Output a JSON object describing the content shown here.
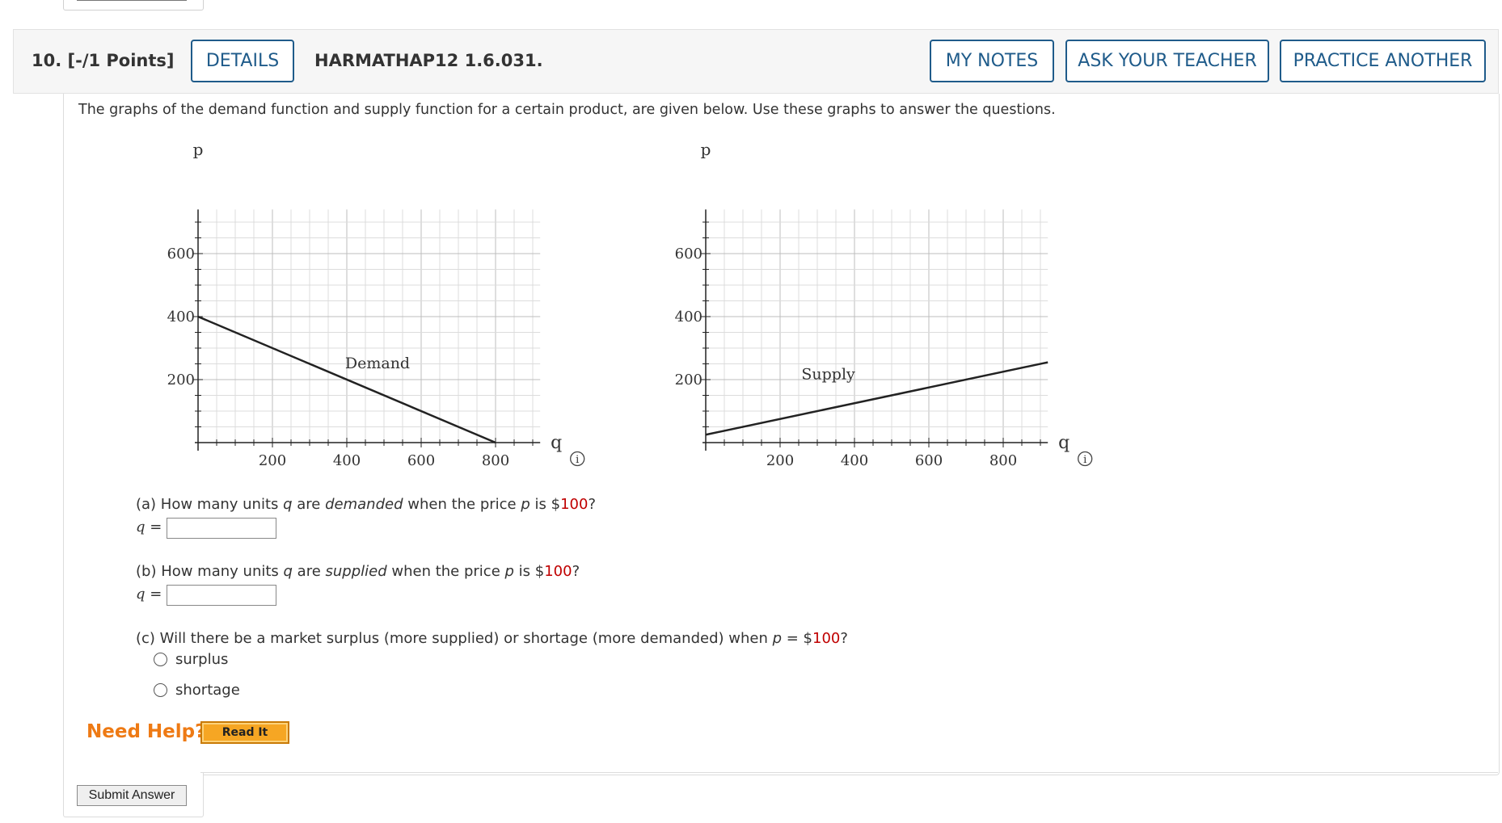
{
  "question": {
    "number_label": "10.  [-/1 Points]",
    "details_label": "DETAILS",
    "code": "HARMATHAP12 1.6.031.",
    "my_notes_label": "MY NOTES",
    "ask_teacher_label": "ASK YOUR TEACHER",
    "practice_label": "PRACTICE ANOTHER",
    "prompt": "The graphs of the demand function and supply function for a certain product, are given below. Use these graphs to answer the questions."
  },
  "chart_data": [
    {
      "type": "line",
      "xlabel": "q",
      "ylabel": "p",
      "x_ticks": [
        "200",
        "400",
        "600",
        "800"
      ],
      "y_ticks": [
        "600",
        "400",
        "200"
      ],
      "xlim": [
        0,
        920
      ],
      "ylim": [
        0,
        740
      ],
      "series": [
        {
          "name": "Demand",
          "x": [
            0,
            800
          ],
          "y": [
            400,
            0
          ]
        }
      ],
      "grid": true,
      "info_icon": "info-icon"
    },
    {
      "type": "line",
      "xlabel": "q",
      "ylabel": "p",
      "x_ticks": [
        "200",
        "400",
        "600",
        "800"
      ],
      "y_ticks": [
        "600",
        "400",
        "200"
      ],
      "xlim": [
        0,
        920
      ],
      "ylim": [
        0,
        740
      ],
      "series": [
        {
          "name": "Supply",
          "x": [
            0,
            920
          ],
          "y": [
            25,
            255
          ]
        }
      ],
      "grid": true,
      "info_icon": "info-icon"
    }
  ],
  "parts": {
    "a": {
      "pre": "(a) How many units ",
      "var": "q",
      "mid": " are ",
      "em": "demanded",
      "post": " when the price ",
      "pvar": "p",
      "is": " is $",
      "price": "100",
      "end": "?",
      "answer_label": "q",
      "eq": " =",
      "answer_value": ""
    },
    "b": {
      "pre": "(b) How many units ",
      "var": "q",
      "mid": " are ",
      "em": "supplied",
      "post": " when the price ",
      "pvar": "p",
      "is": " is $",
      "price": "100",
      "end": "?",
      "answer_label": "q",
      "eq": " =",
      "answer_value": ""
    },
    "c": {
      "text": "(c) Will there be a market surplus (more supplied) or shortage (more demanded) when ",
      "pvar": "p",
      "eq": " = $",
      "price": "100",
      "end": "?",
      "options": [
        "surplus",
        "shortage"
      ]
    }
  },
  "help": {
    "need_help": "Need Help?",
    "read_it": "Read It"
  },
  "submit_label": "Submit Answer",
  "colors": {
    "accent": "#1f5b8a",
    "price_red": "#c00000",
    "help_orange": "#ee7a14",
    "read_it_bg": "#f6a623"
  }
}
